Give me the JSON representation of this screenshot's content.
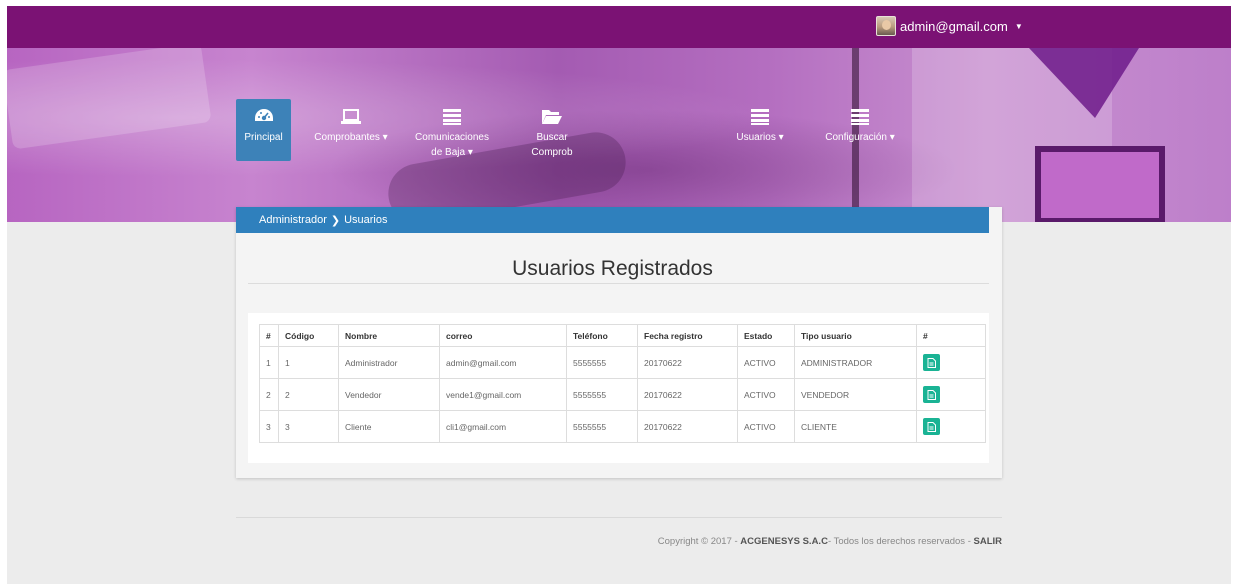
{
  "topbar": {
    "user_email": "admin@gmail.com"
  },
  "nav": {
    "items": [
      {
        "label": "Principal",
        "icon": "dashboard-icon"
      },
      {
        "label": "Comprobantes ▾",
        "icon": "laptop-icon"
      },
      {
        "label": "Comunicaciones",
        "label2": "de Baja ▾",
        "icon": "list-icon"
      },
      {
        "label": "Buscar",
        "label2": "Comprob",
        "icon": "folder-open-icon"
      },
      {
        "label": "Usuarios ▾",
        "icon": "list-icon"
      },
      {
        "label": "Configuración ▾",
        "icon": "list-icon"
      }
    ]
  },
  "breadcrumb": {
    "root": "Administrador",
    "separator": "❯",
    "current": "Usuarios"
  },
  "page": {
    "title": "Usuarios Registrados"
  },
  "table": {
    "headers": [
      "#",
      "Código",
      "Nombre",
      "correo",
      "Teléfono",
      "Fecha registro",
      "Estado",
      "Tipo usuario",
      "#"
    ],
    "rows": [
      {
        "idx": "1",
        "codigo": "1",
        "nombre": "Administrador",
        "correo": "admin@gmail.com",
        "telefono": "5555555",
        "fecha": "20170622",
        "estado": "ACTIVO",
        "tipo": "ADMINISTRADOR"
      },
      {
        "idx": "2",
        "codigo": "2",
        "nombre": "Vendedor",
        "correo": "vende1@gmail.com",
        "telefono": "5555555",
        "fecha": "20170622",
        "estado": "ACTIVO",
        "tipo": "VENDEDOR"
      },
      {
        "idx": "3",
        "codigo": "3",
        "nombre": "Cliente",
        "correo": "cli1@gmail.com",
        "telefono": "5555555",
        "fecha": "20170622",
        "estado": "ACTIVO",
        "tipo": "CLIENTE"
      }
    ],
    "action_icon": "document-icon"
  },
  "footer": {
    "prefix": "Copyright © 2017 - ",
    "company": "ACGENESYS S.A.C",
    "middle": "- Todos los derechos reservados - ",
    "exit": "SALIR"
  },
  "colors": {
    "topbar": "#7b1274",
    "nav_active": "#3d82b8",
    "breadcrumb": "#2f80bd",
    "action_button": "#1ab394"
  }
}
